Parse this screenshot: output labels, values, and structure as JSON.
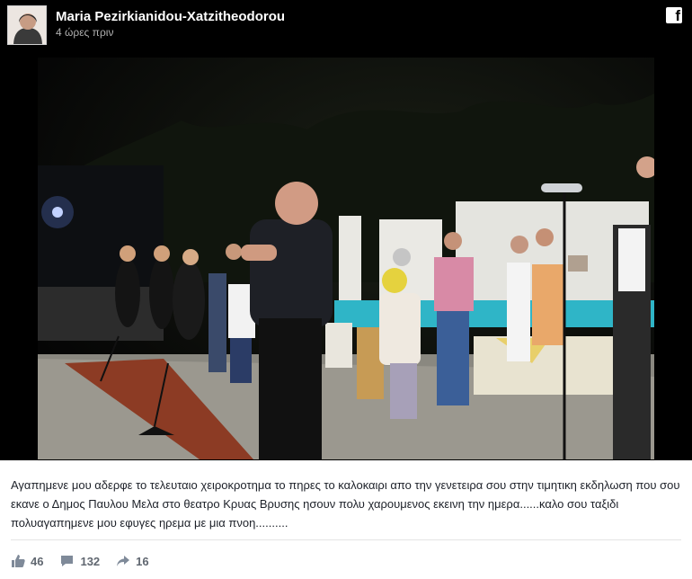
{
  "post": {
    "author": "Maria Pezirkianidou-Xatzitheodorou",
    "time": "4 ώρες πριν",
    "caption": "Αγαπημενε μου αδερφε το τελευταιο χειροκροτημα το πηρες το καλοκαιρι απο την γενετειρα σου στην τιμητικη εκδηλωση που σου εκανε ο Δημος Παυλου Μελα στο θεατρο Κρυας Βρυσης ησουν πολυ χαρουμενος εκεινη την ημερα......καλο σου ταξιδι πολυαγαπημενε μου εφυγες ηρεμα με μια πνοη..........",
    "likes": "46",
    "comments": "132",
    "shares": "16"
  },
  "icons": {
    "brand": "facebook-icon",
    "like": "thumbs-up-icon",
    "comment": "comment-icon",
    "share": "share-arrow-icon"
  },
  "colors": {
    "background": "#000000",
    "text": "#1d2129",
    "muted": "#606770"
  }
}
